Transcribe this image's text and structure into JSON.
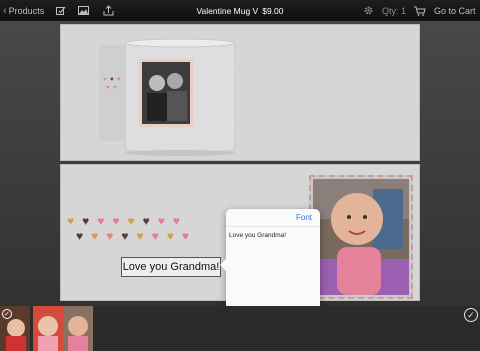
{
  "toolbar": {
    "back_label": "Products",
    "title": "Valentine Mug V",
    "price": "$9.00",
    "qty_label": "Qty: 1",
    "go_to_cart": "Go to Cart",
    "icons": [
      "chevron-left-icon",
      "edit-icon",
      "photo-icon",
      "share-icon",
      "gear-icon",
      "cart-icon"
    ]
  },
  "design": {
    "hearts_row1": [
      "tan",
      "brown",
      "pink",
      "pink",
      "tan",
      "brown",
      "pink",
      "pink"
    ],
    "hearts_row2": [
      "brown",
      "tan",
      "pink",
      "brown",
      "tan",
      "pink",
      "tan",
      "pink"
    ],
    "heart_colors": {
      "tan": "#d99a52",
      "brown": "#5a3b2a",
      "pink": "#e87a94"
    },
    "text_box": "Love you Grandma!"
  },
  "popover": {
    "font_button": "Font",
    "text": "Love you Grandma!"
  },
  "strip": {
    "thumbnails": [
      "photo-thumb-1",
      "photo-thumb-2",
      "photo-thumb-3"
    ],
    "done_icon": "check-circle-icon"
  },
  "colors": {
    "accent": "#2f78d8",
    "toolbar_bg": "#141414",
    "panel_bg": "#d6d6d6"
  }
}
